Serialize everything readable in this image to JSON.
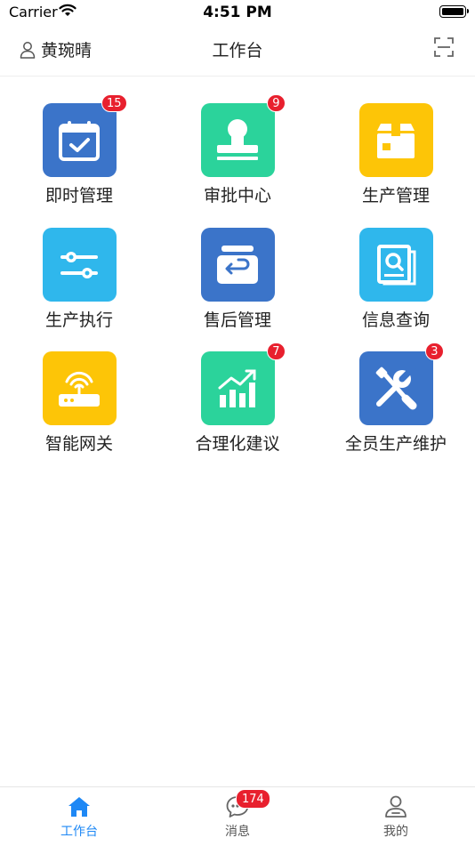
{
  "status_bar": {
    "carrier": "Carrier",
    "time": "4:51 PM"
  },
  "header": {
    "user_name": "黄琬晴",
    "title": "工作台"
  },
  "tiles": [
    {
      "label": "即时管理",
      "badge": "15",
      "color": "#3b74c9",
      "icon": "calendar-check-icon"
    },
    {
      "label": "审批中心",
      "badge": "9",
      "color": "#2bd39b",
      "icon": "stamp-icon"
    },
    {
      "label": "生产管理",
      "badge": "",
      "color": "#fdc507",
      "icon": "box-icon"
    },
    {
      "label": "生产执行",
      "badge": "",
      "color": "#2fb7ec",
      "icon": "sliders-icon"
    },
    {
      "label": "售后管理",
      "badge": "",
      "color": "#3b74c9",
      "icon": "return-box-icon"
    },
    {
      "label": "信息查询",
      "badge": "",
      "color": "#2fb7ec",
      "icon": "search-document-icon"
    },
    {
      "label": "智能网关",
      "badge": "",
      "color": "#fdc507",
      "icon": "router-icon"
    },
    {
      "label": "合理化建议",
      "badge": "7",
      "color": "#2bd39b",
      "icon": "growth-chart-icon"
    },
    {
      "label": "全员生产维护",
      "badge": "3",
      "color": "#3b74c9",
      "icon": "tools-icon"
    }
  ],
  "tab_bar": {
    "items": [
      {
        "label": "工作台",
        "icon": "home-icon",
        "active": true
      },
      {
        "label": "消息",
        "icon": "chat-icon",
        "badge": "174"
      },
      {
        "label": "我的",
        "icon": "profile-icon"
      }
    ]
  },
  "colors": {
    "accent": "#1e88f5",
    "badge": "#e8202e"
  }
}
